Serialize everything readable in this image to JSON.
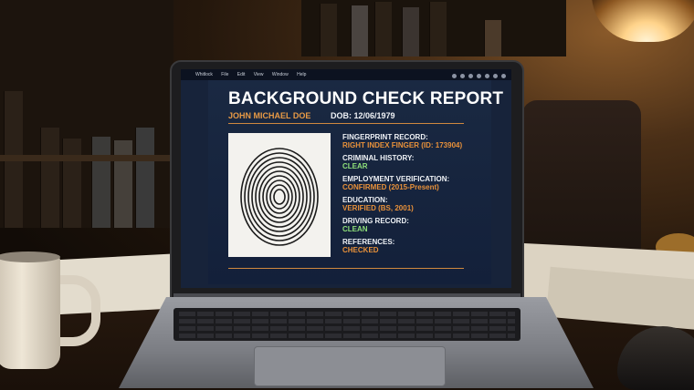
{
  "menubar": {
    "items": [
      "",
      "Whitlock",
      "File",
      "Edit",
      "View",
      "Window",
      "Help"
    ]
  },
  "report": {
    "title": "BACKGROUND CHECK REPORT",
    "name": "JOHN MICHAEL DOE",
    "dob": "DOB: 12/06/1979",
    "fields": [
      {
        "label": "FINGERPRINT RECORD:",
        "value": "RIGHT INDEX FINGER (ID: 173904)",
        "status": "orange"
      },
      {
        "label": "CRIMINAL HISTORY:",
        "value": "CLEAR",
        "status": "green"
      },
      {
        "label": "EMPLOYMENT VERIFICATION:",
        "value": "CONFIRMED (2015-Present)",
        "status": "orange"
      },
      {
        "label": "EDUCATION:",
        "value": "VERIFIED (BS, 2001)",
        "status": "orange"
      },
      {
        "label": "DRIVING RECORD:",
        "value": "CLEAN",
        "status": "green"
      },
      {
        "label": "REFERENCES:",
        "value": "CHECKED",
        "status": "orange"
      }
    ]
  },
  "icons": {
    "fingerprint": "fingerprint-icon",
    "apple": "apple-logo-icon"
  },
  "colors": {
    "accent_orange": "#e8913a",
    "status_green": "#8fe07a",
    "report_background": "#17233a"
  }
}
